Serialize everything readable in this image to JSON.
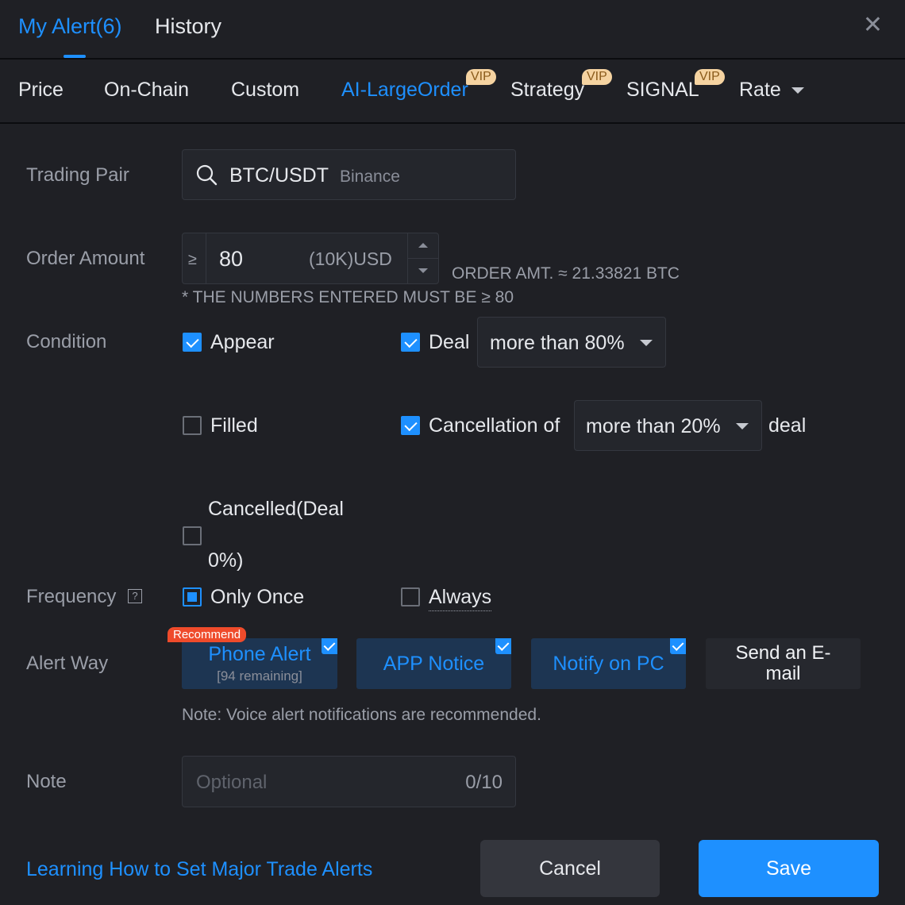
{
  "top_tabs": [
    "My Alert(6)",
    "History"
  ],
  "sub_tabs": {
    "items": [
      "Price",
      "On-Chain",
      "Custom",
      "AI-LargeOrder",
      "Strategy",
      "SIGNAL",
      "Rate"
    ],
    "active": "AI-LargeOrder",
    "vip_label": "VIP"
  },
  "trading_pair": {
    "label": "Trading Pair",
    "pair": "BTC/USDT",
    "exchange": "Binance"
  },
  "order_amount": {
    "label": "Order Amount",
    "prefix": "≥",
    "value": "80",
    "unit": "(10K)USD",
    "converted": "ORDER AMT. ≈ 21.33821 BTC",
    "hint": "* THE NUMBERS ENTERED MUST BE ≥ 80"
  },
  "condition": {
    "label": "Condition",
    "appear": "Appear",
    "deal": "Deal",
    "deal_select": "more than 80%",
    "filled": "Filled",
    "cancellation": "Cancellation of",
    "cancel_select": "more than 20%",
    "cancel_suffix": "deal",
    "cancelled_line1": "Cancelled(Deal",
    "cancelled_line2": "0%)"
  },
  "frequency": {
    "label": "Frequency",
    "help": "?",
    "only_once": "Only Once",
    "always": "Always"
  },
  "alert_way": {
    "label": "Alert Way",
    "recommend": "Recommend",
    "phone": "Phone Alert",
    "phone_remaining": "[94 remaining]",
    "app": "APP Notice",
    "pc": "Notify on PC",
    "email_line1": "Send an E-",
    "email_line2": "mail",
    "note": "Note: Voice alert notifications are recommended."
  },
  "note": {
    "label": "Note",
    "placeholder": "Optional",
    "counter": "0/10"
  },
  "footer": {
    "link": "Learning How to Set Major Trade Alerts",
    "cancel": "Cancel",
    "save": "Save"
  },
  "colors": {
    "accent": "#1e90ff",
    "background": "#1f2025",
    "recommend_badge": "#ef4b2b",
    "vip_badge": "#f5d3a1"
  }
}
